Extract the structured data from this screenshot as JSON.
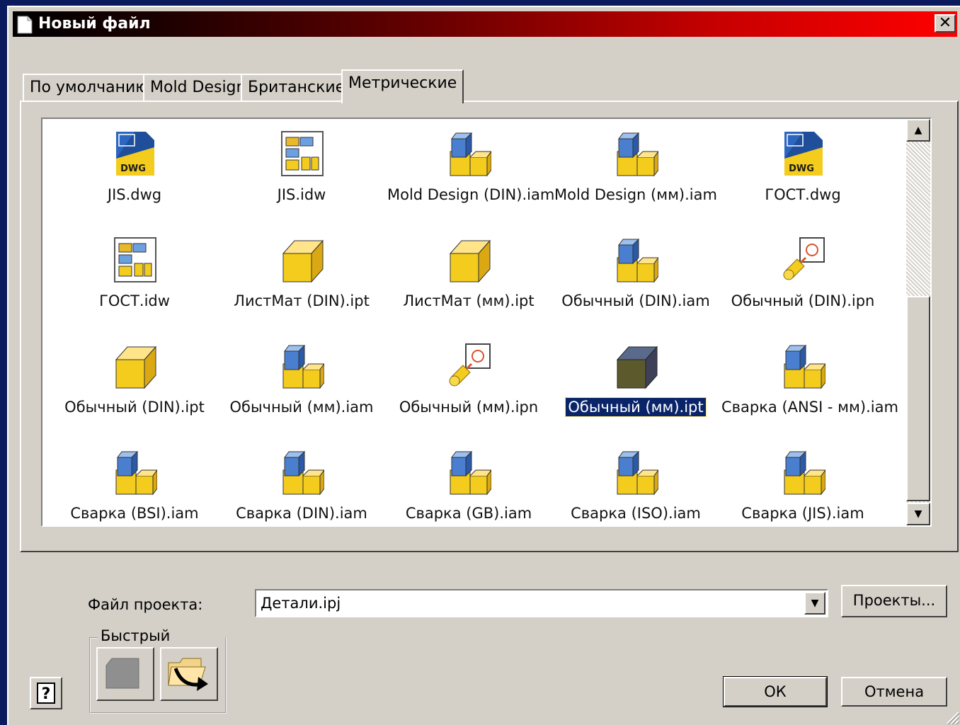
{
  "window": {
    "title": "Новый файл",
    "close_glyph": "✕"
  },
  "tabs": [
    {
      "label": "По умолчанию",
      "active": false
    },
    {
      "label": "Mold Design",
      "active": false
    },
    {
      "label": "Британские",
      "active": false
    },
    {
      "label": "Метрические",
      "active": true
    }
  ],
  "files": [
    {
      "label": "JIS.dwg",
      "icon": "dwg-icon"
    },
    {
      "label": "JIS.idw",
      "icon": "idw-icon"
    },
    {
      "label": "Mold Design (DIN).iam",
      "icon": "assembly-icon"
    },
    {
      "label": "Mold Design (мм).iam",
      "icon": "assembly-icon"
    },
    {
      "label": "ГОСТ.dwg",
      "icon": "dwg-icon"
    },
    {
      "label": "ГОСТ.idw",
      "icon": "idw-icon"
    },
    {
      "label": "ЛистМат (DIN).ipt",
      "icon": "part-icon"
    },
    {
      "label": "ЛистМат (мм).ipt",
      "icon": "part-icon"
    },
    {
      "label": "Обычный (DIN).iam",
      "icon": "assembly-icon"
    },
    {
      "label": "Обычный (DIN).ipn",
      "icon": "presentation-icon"
    },
    {
      "label": "Обычный (DIN).ipt",
      "icon": "part-icon"
    },
    {
      "label": "Обычный (мм).iam",
      "icon": "assembly-icon"
    },
    {
      "label": "Обычный (мм).ipn",
      "icon": "presentation-icon"
    },
    {
      "label": "Обычный (мм).ipt",
      "icon": "part-dark-icon",
      "selected": true
    },
    {
      "label": "Сварка (ANSI - мм).iam",
      "icon": "assembly-icon"
    },
    {
      "label": "Сварка (BSI).iam",
      "icon": "assembly-icon"
    },
    {
      "label": "Сварка (DIN).iam",
      "icon": "assembly-icon"
    },
    {
      "label": "Сварка (GB).iam",
      "icon": "assembly-icon"
    },
    {
      "label": "Сварка (ISO).iam",
      "icon": "assembly-icon"
    },
    {
      "label": "Сварка (JIS).iam",
      "icon": "assembly-icon"
    }
  ],
  "project": {
    "label": "Файл проекта:",
    "value": "Детали.ipj",
    "projects_button": "Проекты..."
  },
  "quick_launch": {
    "legend": "Быстрый запуск",
    "buttons": [
      "new-file-icon",
      "open-folder-icon"
    ]
  },
  "buttons": {
    "ok": "ОК",
    "cancel": "Отмена",
    "help_icon": "help-icon"
  },
  "colors": {
    "title_gradient_end": "#ff0000",
    "selection": "#0a246a",
    "dialog_bg": "#d4d0c8"
  }
}
